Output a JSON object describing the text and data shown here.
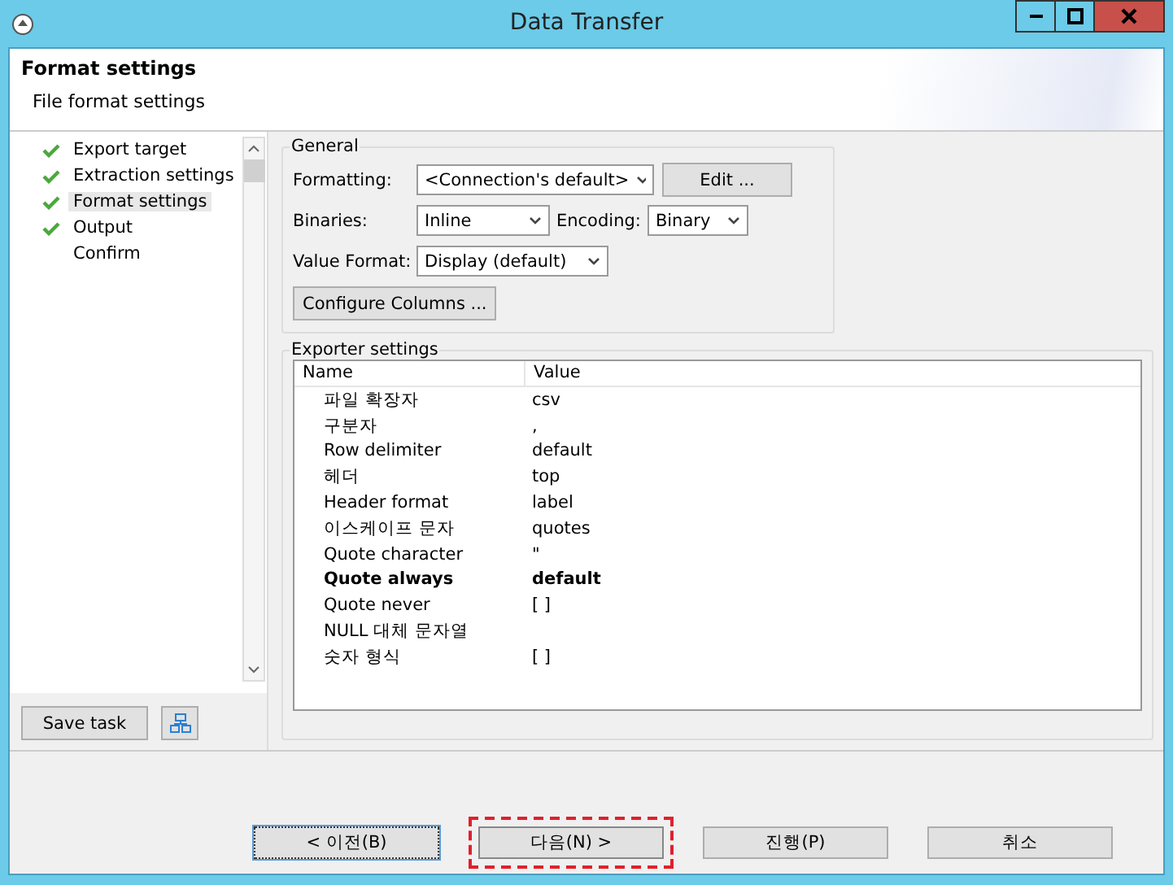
{
  "window": {
    "title": "Data Transfer"
  },
  "header": {
    "title": "Format settings",
    "subtitle": "File format settings"
  },
  "steps": [
    {
      "label": "Export target",
      "done": true,
      "selected": false
    },
    {
      "label": "Extraction settings",
      "done": true,
      "selected": false
    },
    {
      "label": "Format settings",
      "done": true,
      "selected": true
    },
    {
      "label": "Output",
      "done": true,
      "selected": false
    },
    {
      "label": "Confirm",
      "done": false,
      "selected": false
    }
  ],
  "save_task": "Save task",
  "general": {
    "legend": "General",
    "formatting": {
      "label": "Formatting:",
      "value": "<Connection's default>"
    },
    "edit_button": "Edit ...",
    "binaries": {
      "label": "Binaries:",
      "value": "Inline"
    },
    "encoding": {
      "label": "Encoding:",
      "value": "Binary"
    },
    "value_format": {
      "label": "Value Format:",
      "value": "Display (default)"
    },
    "configure_button": "Configure Columns ..."
  },
  "exporter": {
    "legend": "Exporter settings",
    "columns": [
      "Name",
      "Value"
    ],
    "rows": [
      {
        "name": "파일 확장자",
        "value": "csv",
        "changed": false
      },
      {
        "name": "구분자",
        "value": ",",
        "changed": false
      },
      {
        "name": "Row delimiter",
        "value": "default",
        "changed": false
      },
      {
        "name": "헤더",
        "value": "top",
        "changed": false
      },
      {
        "name": "Header format",
        "value": "label",
        "changed": false
      },
      {
        "name": "이스케이프 문자",
        "value": "quotes",
        "changed": false
      },
      {
        "name": "Quote character",
        "value": "\"",
        "changed": false
      },
      {
        "name": "Quote always",
        "value": "default",
        "changed": true
      },
      {
        "name": "Quote never",
        "value": "[ ]",
        "changed": false
      },
      {
        "name": "NULL 대체 문자열",
        "value": "",
        "changed": false
      },
      {
        "name": "숫자 형식",
        "value": "[ ]",
        "changed": false
      }
    ]
  },
  "buttons": [
    {
      "label": "< 이전(B)",
      "focused": true,
      "highlighted": false
    },
    {
      "label": "다음(N) >",
      "focused": false,
      "highlighted": true
    },
    {
      "label": "진행(P)",
      "focused": false,
      "highlighted": false
    },
    {
      "label": "취소",
      "focused": false,
      "highlighted": false
    }
  ]
}
